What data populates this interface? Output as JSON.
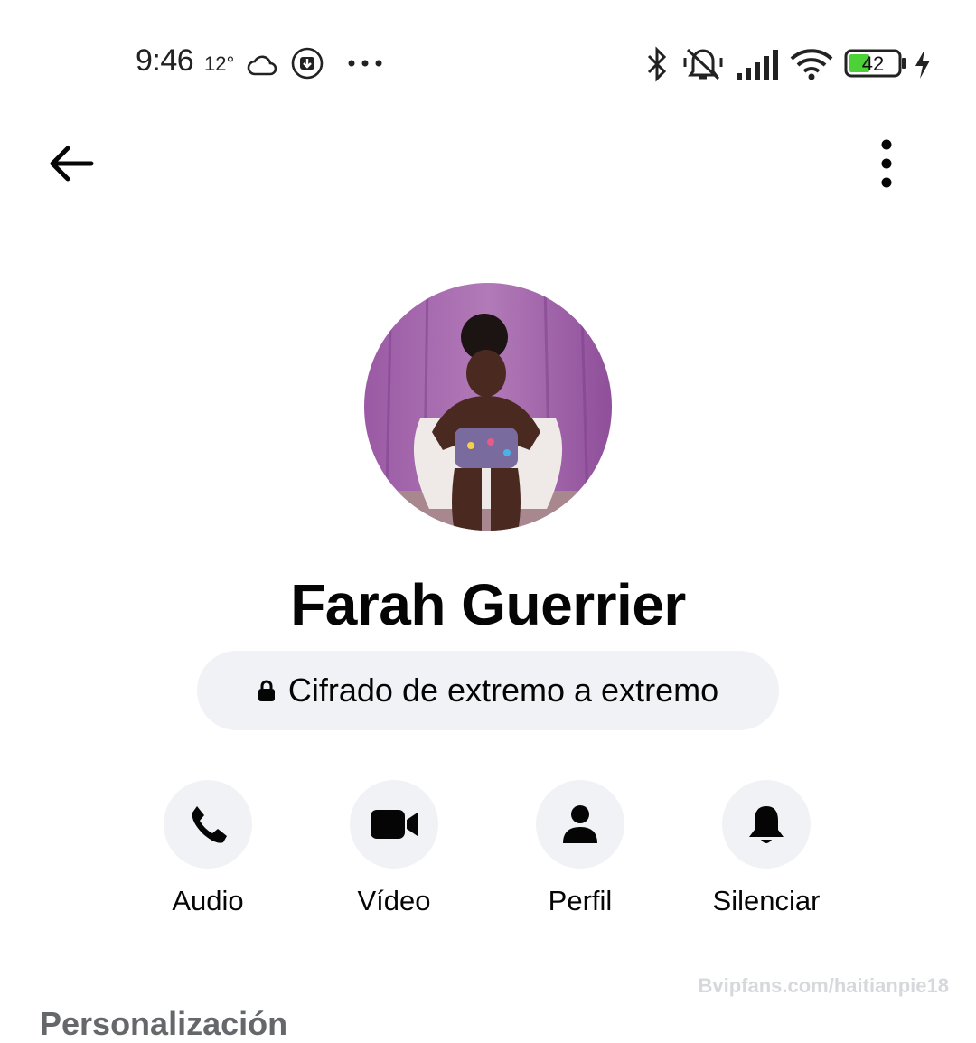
{
  "status_bar": {
    "time": "9:46",
    "temperature": "12°",
    "battery": "42",
    "icons": [
      "weather-cloud-icon",
      "download-icon",
      "more-dots-icon",
      "bluetooth-icon",
      "mute-icon",
      "signal-icon",
      "wifi-icon",
      "battery-icon",
      "charging-icon"
    ]
  },
  "header": {
    "back_icon": "arrow-left-icon",
    "menu_icon": "more-vertical-icon"
  },
  "profile": {
    "name": "Farah Guerrier",
    "encryption_label": "Cifrado de extremo a extremo"
  },
  "actions": [
    {
      "label": "Audio",
      "icon": "phone-icon"
    },
    {
      "label": "Vídeo",
      "icon": "video-camera-icon"
    },
    {
      "label": "Perfil",
      "icon": "person-icon"
    },
    {
      "label": "Silenciar",
      "icon": "bell-icon"
    }
  ],
  "watermark": "Bvipfans.com/haitianpie18",
  "section": {
    "title": "Personalización"
  },
  "colors": {
    "pill_bg": "#f0f2f5",
    "text": "#050505",
    "battery_green": "#4cd137"
  }
}
